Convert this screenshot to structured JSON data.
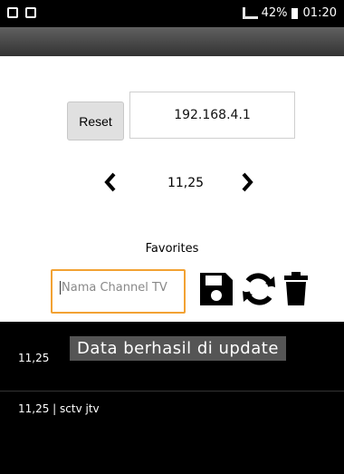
{
  "status": {
    "battery": "42%",
    "time": "01:20"
  },
  "controls": {
    "reset_label": "Reset",
    "ip_value": "192.168.4.1",
    "prev_icon": "chevron-left-icon",
    "channel_value": "11,25",
    "next_icon": "chevron-right-icon"
  },
  "favorites": {
    "label": "Favorites",
    "input_placeholder": "Nama Channel TV",
    "save_icon": "save-icon",
    "refresh_icon": "refresh-icon",
    "delete_icon": "trash-icon"
  },
  "list": {
    "rows": [
      "11,25",
      "11,25 | sctv jtv"
    ]
  },
  "toast": {
    "text": "Data berhasil di update"
  },
  "colors": {
    "focus": "#f2a233",
    "status_bar": "#000000",
    "list_bg": "#000000",
    "toast_bg": "#555555"
  }
}
